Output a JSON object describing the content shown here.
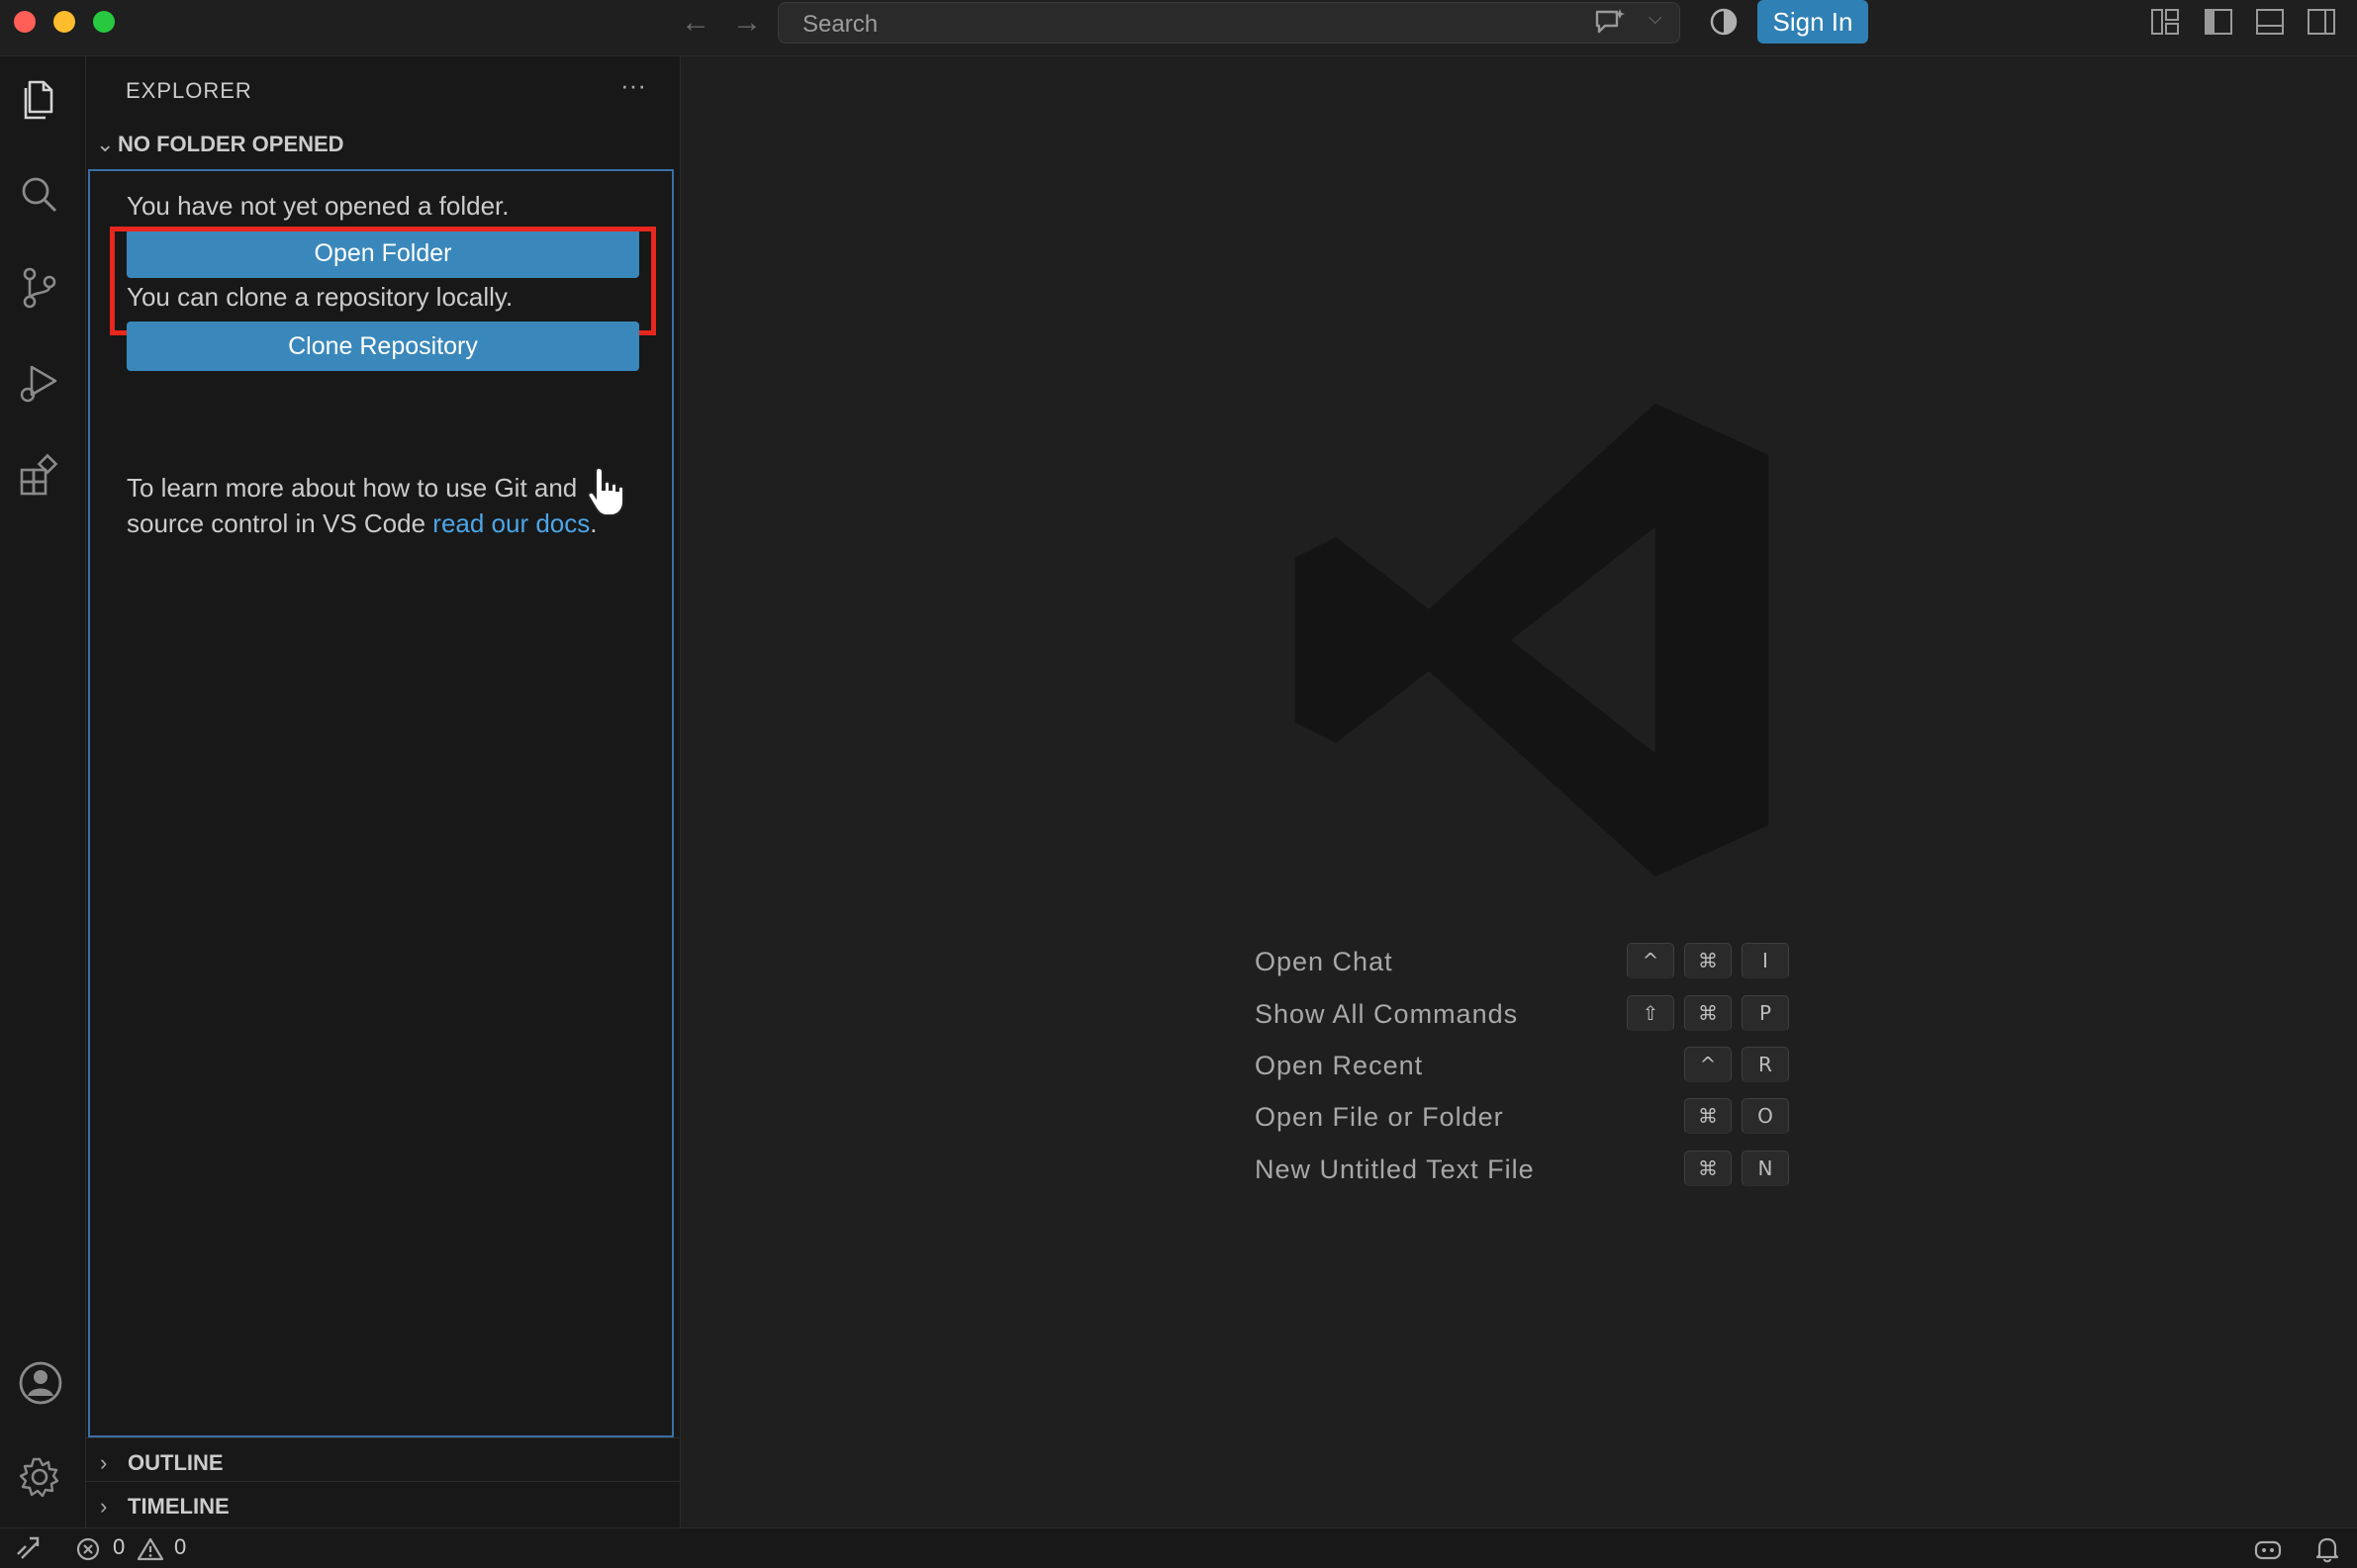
{
  "window": {
    "search_placeholder": "Search",
    "sign_in_label": "Sign In"
  },
  "sidebar": {
    "title": "EXPLORER",
    "more_label": "···",
    "section_title": "NO FOLDER OPENED",
    "no_folder_msg": "You have not yet opened a folder.",
    "open_folder_label": "Open Folder",
    "clone_msg": "You can clone a repository locally.",
    "clone_label": "Clone Repository",
    "learn_prefix": "To learn more about how to use Git and source control in VS Code ",
    "learn_link": "read our docs",
    "learn_suffix": ".",
    "outline_label": "OUTLINE",
    "timeline_label": "TIMELINE"
  },
  "editor": {
    "shortcuts": [
      {
        "label": "Open Chat",
        "keys": [
          "^",
          "⌘",
          "I"
        ]
      },
      {
        "label": "Show All Commands",
        "keys": [
          "⇧",
          "⌘",
          "P"
        ]
      },
      {
        "label": "Open Recent",
        "keys": [
          "^",
          "R"
        ]
      },
      {
        "label": "Open File or Folder",
        "keys": [
          "⌘",
          "O"
        ]
      },
      {
        "label": "New Untitled Text File",
        "keys": [
          "⌘",
          "N"
        ]
      }
    ]
  },
  "statusbar": {
    "errors": "0",
    "warnings": "0"
  },
  "colors": {
    "accent": "#3a88bb",
    "highlight_box": "#e8271e",
    "link": "#4ca6e8"
  }
}
